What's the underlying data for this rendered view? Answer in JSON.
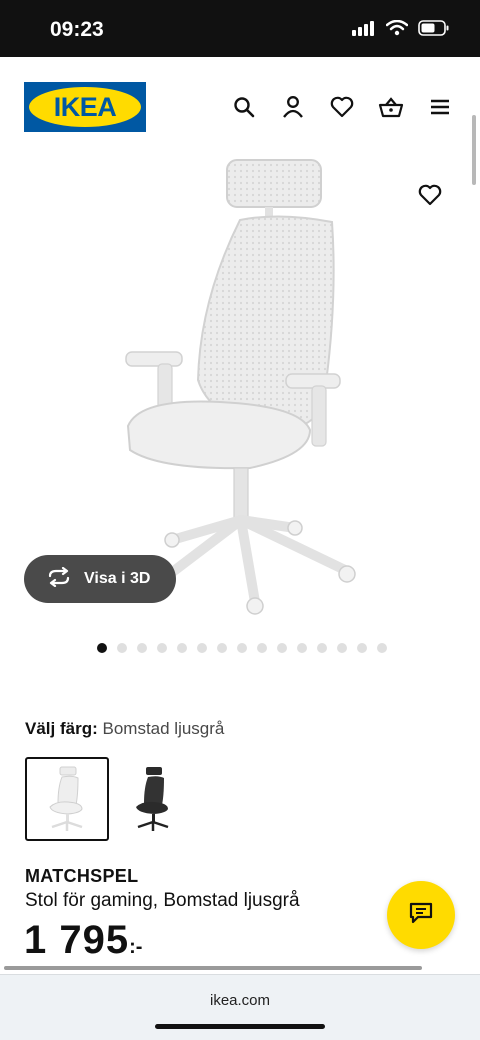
{
  "status_bar": {
    "time": "09:23"
  },
  "header": {
    "logo_text": "IKEA",
    "icons": [
      "search-icon",
      "user-icon",
      "heart-icon",
      "basket-icon",
      "menu-icon"
    ]
  },
  "product": {
    "view_3d_label": "Visa i 3D",
    "image_count": 15,
    "active_image": 1,
    "color_label": "Välj färg:",
    "color_value": "Bomstad ljusgrå",
    "swatches": [
      {
        "name": "Bomstad ljusgrå",
        "selected": true
      },
      {
        "name": "Bomstad svart",
        "selected": false
      }
    ],
    "name": "MATCHSPEL",
    "description": "Stol för gaming, Bomstad ljusgrå",
    "price_amount": "1 795",
    "price_suffix": ":-"
  },
  "browser": {
    "url": "ikea.com"
  },
  "colors": {
    "brand_blue": "#0058a3",
    "brand_yellow": "#ffdb00"
  }
}
